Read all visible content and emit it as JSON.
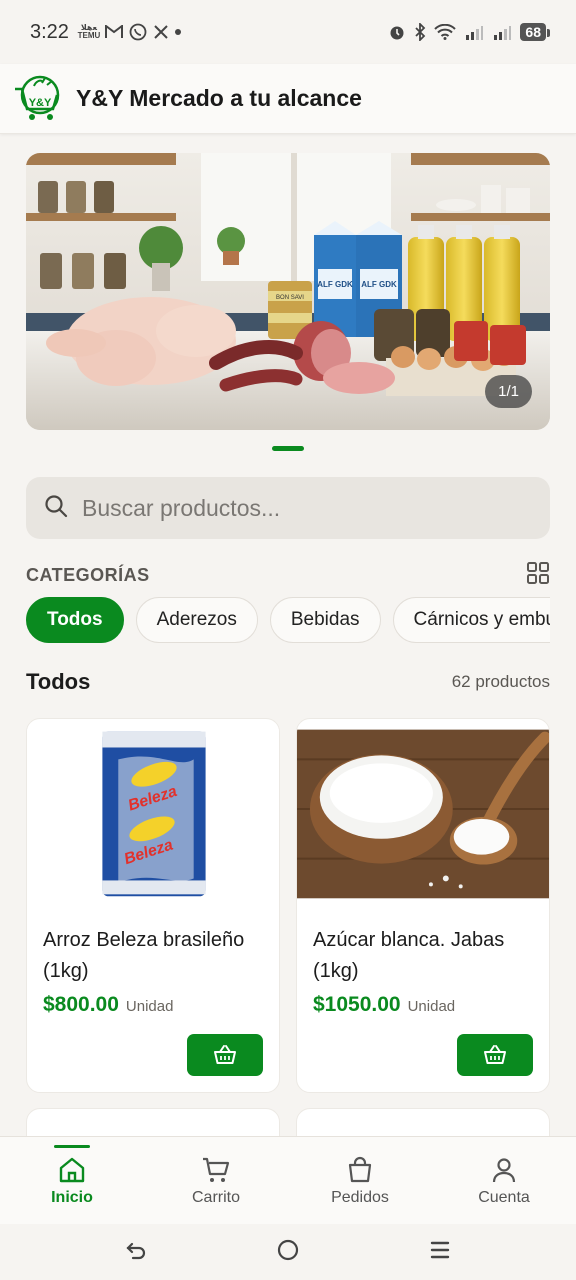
{
  "status_bar": {
    "time": "3:22",
    "temu_label": "ﻌﻫﻼ TEMU",
    "battery": "68"
  },
  "header": {
    "logo_text": "Y&Y",
    "title": "Y&Y Mercado a tu alcance"
  },
  "banner": {
    "counter": "1/1",
    "carton_label": "ALF GDK",
    "can_label": "BON SAVI"
  },
  "search": {
    "placeholder": "Buscar productos..."
  },
  "categories": {
    "title": "CATEGORÍAS",
    "chips": [
      "Todos",
      "Aderezos",
      "Bebidas",
      "Cárnicos y embutidos"
    ]
  },
  "section": {
    "title": "Todos",
    "count": "62 productos"
  },
  "products": [
    {
      "name": "Arroz Beleza brasileño (1kg)",
      "price": "$800.00",
      "unit": "Unidad",
      "brand_text": "Beleza"
    },
    {
      "name": "Azúcar blanca. Jabas (1kg)",
      "price": "$1050.00",
      "unit": "Unidad"
    }
  ],
  "bottom_nav": {
    "items": [
      "Inicio",
      "Carrito",
      "Pedidos",
      "Cuenta"
    ]
  },
  "colors": {
    "primary": "#0a8a1f",
    "background": "#f6f4f1"
  }
}
